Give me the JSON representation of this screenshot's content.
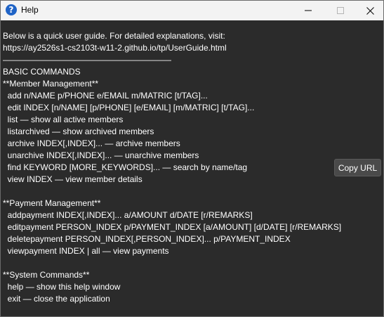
{
  "window": {
    "title": "Help",
    "app_icon_glyph": "?",
    "accent_color": "#1f63c6"
  },
  "guide_lines": [
    "Below is a quick user guide. For detailed explanations, visit:",
    "https://ay2526s1-cs2103t-w11-2.github.io/tp/UserGuide.html",
    "————————————————————",
    "BASIC COMMANDS",
    "**Member Management**",
    "  add n/NAME p/PHONE e/EMAIL m/MATRIC [t/TAG]...",
    "  edit INDEX [n/NAME] [p/PHONE] [e/EMAIL] [m/MATRIC] [t/TAG]...",
    "  list — show all active members",
    "  listarchived — show archived members",
    "  archive INDEX[,INDEX]... — archive members",
    "  unarchive INDEX[,INDEX]... — unarchive members",
    "  find KEYWORD [MORE_KEYWORDS]... — search by name/tag",
    "  view INDEX — view member details",
    "",
    "**Payment Management**",
    "  addpayment INDEX[,INDEX]... a/AMOUNT d/DATE [r/REMARKS]",
    "  editpayment PERSON_INDEX p/PAYMENT_INDEX [a/AMOUNT] [d/DATE] [r/REMARKS]",
    "  deletepayment PERSON_INDEX[,PERSON_INDEX]... p/PAYMENT_INDEX",
    "  viewpayment INDEX | all — view payments",
    "",
    "**System Commands**",
    "  help — show this help window",
    "  exit — close the application"
  ],
  "copy_button": {
    "label": "Copy URL"
  },
  "icons": {
    "minimize": "minimize-icon",
    "maximize": "maximize-icon",
    "close": "close-icon"
  }
}
